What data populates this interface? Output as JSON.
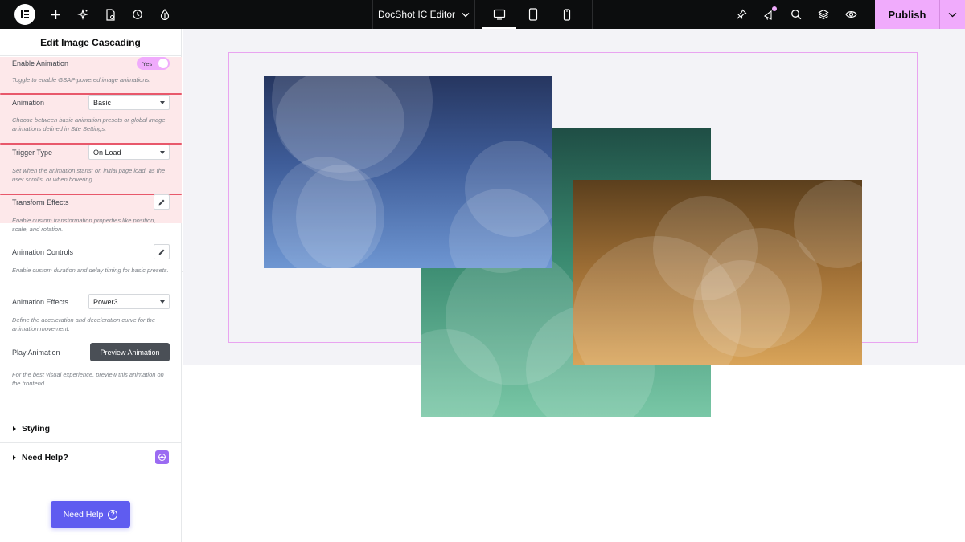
{
  "app": {
    "title": "DocShot IC Editor",
    "publish_label": "Publish"
  },
  "toolbar": {
    "left_icons": [
      "elementor-logo-icon",
      "add-icon",
      "ai-sparkle-icon",
      "page-settings-icon",
      "history-icon",
      "site-settings-icon"
    ],
    "devices": [
      "desktop-icon",
      "tablet-icon",
      "mobile-icon"
    ],
    "active_device": "desktop",
    "right_icons": [
      "pin-icon",
      "notifications-icon",
      "search-icon",
      "structure-layers-icon",
      "preview-eye-icon"
    ]
  },
  "panel": {
    "title": "Edit Image Cascading",
    "enable_animation": {
      "label": "Enable Animation",
      "toggle_value": "Yes",
      "desc": "Toggle to enable GSAP-powered image animations."
    },
    "animation": {
      "label": "Animation",
      "value": "Basic",
      "desc": "Choose between basic animation presets or global image animations defined in Site Settings."
    },
    "trigger_type": {
      "label": "Trigger Type",
      "value": "On Load",
      "desc": "Set when the animation starts: on initial page load, as the user scrolls, or when hovering."
    },
    "transform_effects": {
      "label": "Transform Effects",
      "desc": "Enable custom transformation properties like position, scale, and rotation."
    },
    "animation_controls": {
      "label": "Animation Controls",
      "desc": "Enable custom duration and delay timing for basic presets."
    },
    "animation_effects": {
      "label": "Animation Effects",
      "value": "Power3",
      "desc": "Define the acceleration and deceleration curve for the animation movement."
    },
    "play_animation": {
      "label": "Play Animation",
      "button": "Preview Animation",
      "desc": "For the best visual experience, preview this animation on the frontend."
    },
    "sections": {
      "styling": "Styling",
      "need_help": "Need Help?"
    },
    "need_help_button": "Need Help",
    "need_help_glyph": "?"
  },
  "colors": {
    "accent_pink": "#f0abfc",
    "highlight_bg": "#fde8ea",
    "highlight_line": "#e8586b",
    "help_button": "#5f5cf0"
  }
}
